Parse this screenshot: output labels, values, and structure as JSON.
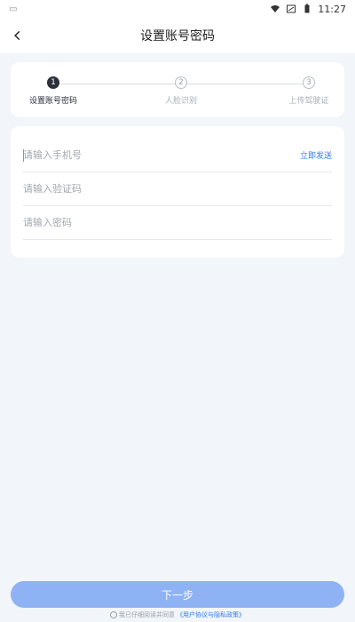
{
  "status_bar": {
    "time": "11:27",
    "icons": [
      "wifi-icon",
      "signal-icon",
      "battery-icon"
    ]
  },
  "header": {
    "title": "设置账号密码",
    "back_icon": "chevron-left-icon"
  },
  "steps": [
    {
      "number": "1",
      "label": "设置账号密码",
      "state": "active"
    },
    {
      "number": "2",
      "label": "人脸识别",
      "state": "inactive"
    },
    {
      "number": "3",
      "label": "上传驾驶证",
      "state": "inactive"
    }
  ],
  "form": {
    "phone": {
      "placeholder": "请输入手机号",
      "value": ""
    },
    "send_code_label": "立即发送",
    "code": {
      "placeholder": "请输入验证码",
      "value": ""
    },
    "password": {
      "placeholder": "请输入密码",
      "value": ""
    }
  },
  "next_button_label": "下一步",
  "agreement": {
    "text": "我已仔细阅读并同意",
    "link": "《用户协议与隐私政策》"
  },
  "colors": {
    "primary": "#2e7bf0",
    "button": "#8fb2f4",
    "step_active": "#2a2f3b",
    "background": "#f2f5f9"
  }
}
